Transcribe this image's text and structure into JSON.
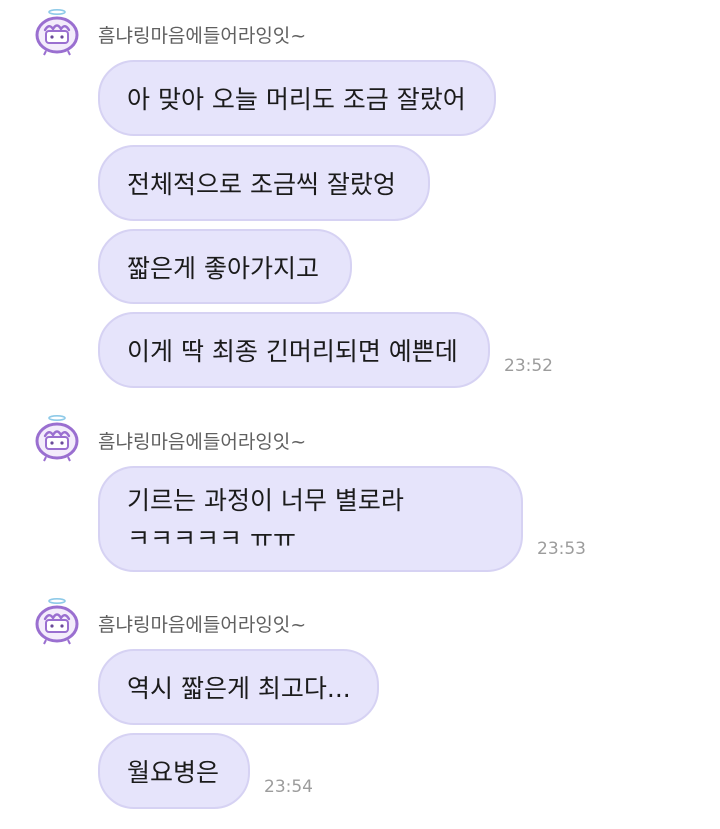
{
  "sender_name": "흠냐링마음에들어라잉잇~",
  "groups": [
    {
      "messages": [
        "아 맞아 오늘 머리도 조금 잘랐어",
        "전체적으로 조금씩 잘랐엉",
        "짧은게 좋아가지고",
        "이게 딱 최종 긴머리되면 예쁜데"
      ],
      "time": "23:52"
    },
    {
      "messages": [
        "기르는 과정이 너무 별로라",
        "ㅋㅋㅋㅋㅋ ㅠㅠ"
      ],
      "time": "23:53"
    },
    {
      "messages": [
        "역시 짧은게 최고다...",
        "월요병은"
      ],
      "time": "23:54"
    }
  ],
  "colors": {
    "bubble": "#e6e4fb",
    "bubble_border": "#d6d2f3",
    "avatar_accent": "#9a6fd0"
  },
  "icons": {
    "avatar": "cake-character-avatar-icon"
  }
}
